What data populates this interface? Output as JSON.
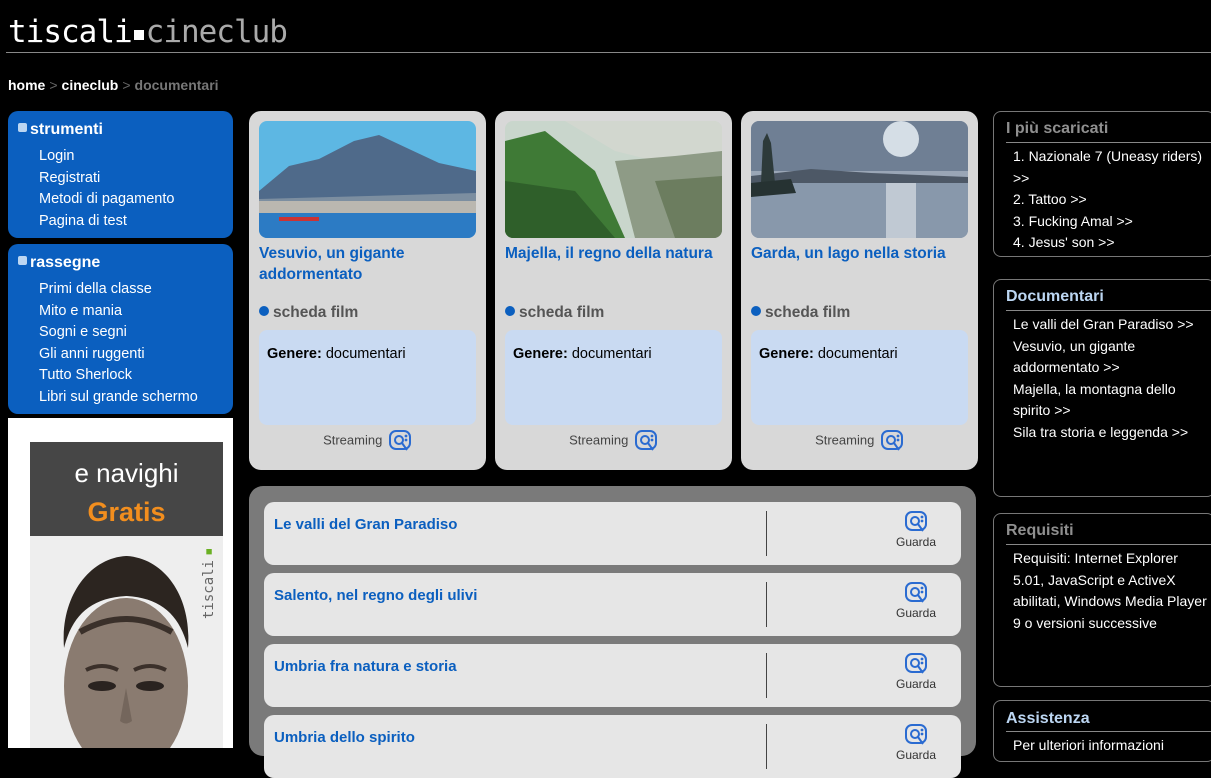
{
  "header": {
    "logo_main": "tiscali",
    "logo_sub": "cineclub"
  },
  "breadcrumb": {
    "home": "home",
    "cineclub": "cineclub",
    "current": "documentari",
    "separator": ">"
  },
  "nav": {
    "strumenti": {
      "heading": "strumenti",
      "items": [
        "Login",
        "Registrati",
        "Metodi di pagamento",
        "Pagina di test"
      ]
    },
    "rassegne": {
      "heading": "rassegne",
      "items": [
        "Primi della classe",
        "Mito e mania",
        "Sogni e segni",
        "Gli anni ruggenti",
        "Tutto Sherlock",
        "Libri sul grande schermo"
      ]
    }
  },
  "ad": {
    "line1": "e navighi",
    "line2": "Gratis",
    "brand": "tiscali"
  },
  "films": [
    {
      "title": "Vesuvio, un gigante addormentato",
      "scheda": "scheda film",
      "genre_label": "Genere:",
      "genre": "documentari",
      "stream": "Streaming"
    },
    {
      "title": "Majella, il regno della natura",
      "scheda": "scheda film",
      "genre_label": "Genere:",
      "genre": "documentari",
      "stream": "Streaming"
    },
    {
      "title": "Garda, un lago nella storia",
      "scheda": "scheda film",
      "genre_label": "Genere:",
      "genre": "documentari",
      "stream": "Streaming"
    }
  ],
  "list": [
    {
      "title": "Le valli del Gran Paradiso",
      "action": "Guarda"
    },
    {
      "title": "Salento, nel regno degli ulivi",
      "action": "Guarda"
    },
    {
      "title": "Umbria fra natura e storia",
      "action": "Guarda"
    },
    {
      "title": "Umbria dello spirito",
      "action": "Guarda"
    }
  ],
  "right": {
    "top": {
      "heading": "I più scaricati",
      "items": [
        "1. Nazionale 7 (Uneasy riders) >>",
        "2. Tattoo >>",
        "3. Fucking Amal >>",
        "4. Jesus' son >>"
      ]
    },
    "documentari": {
      "heading": "Documentari",
      "items": [
        "Le valli del Gran Paradiso >>",
        "Vesuvio, un gigante addormentato >>",
        "Majella, la montagna dello spirito >>",
        "Sila tra storia e leggenda >>"
      ]
    },
    "requisiti": {
      "heading": "Requisiti",
      "text": "Requisiti: Internet Explorer 5.01, JavaScript e ActiveX abilitati, Windows Media Player 9 o versioni successive"
    },
    "assistenza": {
      "heading": "Assistenza",
      "text": "Per ulteriori informazioni"
    }
  },
  "colors": {
    "brand_blue": "#0b5fbf",
    "accent_orange": "#f28e1e",
    "card_gray": "#d8d8d8"
  }
}
